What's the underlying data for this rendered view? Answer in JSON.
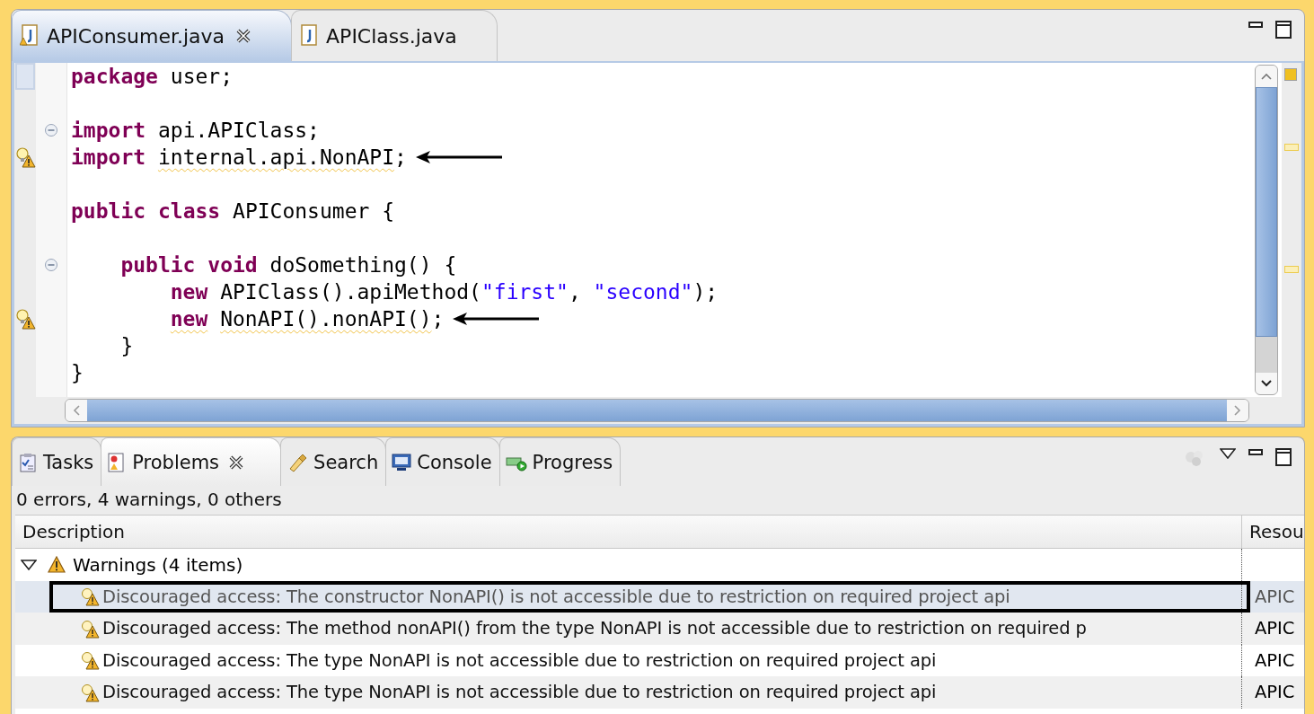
{
  "editor": {
    "tabs": [
      {
        "label": "APIConsumer.java",
        "selected": true,
        "closable": true,
        "warning": true
      },
      {
        "label": "APIClass.java",
        "selected": false,
        "closable": false,
        "warning": false
      }
    ],
    "lines": [
      {
        "kind": "code",
        "tokens": [
          {
            "text": "package",
            "kind": "keyword"
          },
          {
            "text": "user;",
            "kind": "plain"
          }
        ]
      },
      {
        "kind": "blank"
      },
      {
        "kind": "code",
        "fold": true,
        "tokens": [
          {
            "text": "import",
            "kind": "keyword"
          },
          {
            "text": "api.APIClass;",
            "kind": "plain"
          }
        ]
      },
      {
        "kind": "code",
        "warning": true,
        "arrow": true,
        "tokens": [
          {
            "text": "import",
            "kind": "keyword"
          },
          {
            "text": "internal.api.NonAPI",
            "kind": "plain",
            "squiggle": true
          },
          {
            "text": ";",
            "kind": "plain",
            "joined": true
          }
        ]
      },
      {
        "kind": "blank"
      },
      {
        "kind": "code",
        "tokens": [
          {
            "text": "public",
            "kind": "keyword"
          },
          {
            "text": "class",
            "kind": "keyword"
          },
          {
            "text": "APIConsumer {",
            "kind": "plain"
          }
        ],
        "children": [
          {
            "kind": "blank"
          },
          {
            "kind": "code",
            "fold": true,
            "tokens": [
              {
                "text": "public",
                "kind": "keyword"
              },
              {
                "text": "void",
                "kind": "keyword"
              },
              {
                "text": "doSomething() {",
                "kind": "plain"
              }
            ],
            "children": [
              {
                "kind": "code",
                "tokens": [
                  {
                    "text": "new",
                    "kind": "keyword"
                  },
                  {
                    "text": "APIClass().apiMethod(",
                    "kind": "plain"
                  },
                  {
                    "text": "\"first\"",
                    "kind": "string",
                    "joined": true
                  },
                  {
                    "text": ",",
                    "kind": "plain",
                    "joined": true
                  },
                  {
                    "text": "\"second\"",
                    "kind": "string"
                  },
                  {
                    "text": ");",
                    "kind": "plain",
                    "joined": true
                  }
                ]
              },
              {
                "kind": "code",
                "warning": true,
                "arrow": true,
                "tokens": [
                  {
                    "text": "new",
                    "kind": "keyword",
                    "squiggle": true
                  },
                  {
                    "text": "NonAPI().nonAPI()",
                    "kind": "plain",
                    "squiggle": true
                  },
                  {
                    "text": ";",
                    "kind": "plain",
                    "joined": true
                  }
                ]
              }
            ]
          },
          {
            "kind": "code",
            "tokens": [
              {
                "text": "}",
                "kind": "plain"
              }
            ]
          }
        ]
      },
      {
        "kind": "code",
        "tokens": [
          {
            "text": "}",
            "kind": "plain"
          }
        ]
      }
    ]
  },
  "problems": {
    "tabs": [
      {
        "label": "Tasks",
        "kind": "tasks",
        "selected": false,
        "closable": false
      },
      {
        "label": "Problems",
        "kind": "problems",
        "selected": true,
        "closable": true
      },
      {
        "label": "Search",
        "kind": "search",
        "selected": false,
        "closable": false
      },
      {
        "label": "Console",
        "kind": "console",
        "selected": false,
        "closable": false
      },
      {
        "label": "Progress",
        "kind": "progress",
        "selected": false,
        "closable": false
      }
    ],
    "summary": "0 errors, 4 warnings, 0 others",
    "columns": [
      "Description",
      "Resou"
    ],
    "groups": [
      {
        "label": "Warnings (4 items)",
        "expanded": true,
        "children": [
          {
            "description": "Discouraged access: The constructor NonAPI() is not accessible due to restriction on required project api",
            "resource": "APIC",
            "selected": true,
            "highlighted": true
          },
          {
            "description": "Discouraged access: The method nonAPI() from the type NonAPI is not accessible due to restriction on required p",
            "resource": "APIC",
            "selected": false,
            "highlighted": false
          },
          {
            "description": "Discouraged access: The type NonAPI is not accessible due to restriction on required project api",
            "resource": "APIC",
            "selected": false,
            "highlighted": false
          },
          {
            "description": "Discouraged access: The type NonAPI is not accessible due to restriction on required project api",
            "resource": "APIC",
            "selected": false,
            "highlighted": false
          }
        ]
      }
    ]
  }
}
